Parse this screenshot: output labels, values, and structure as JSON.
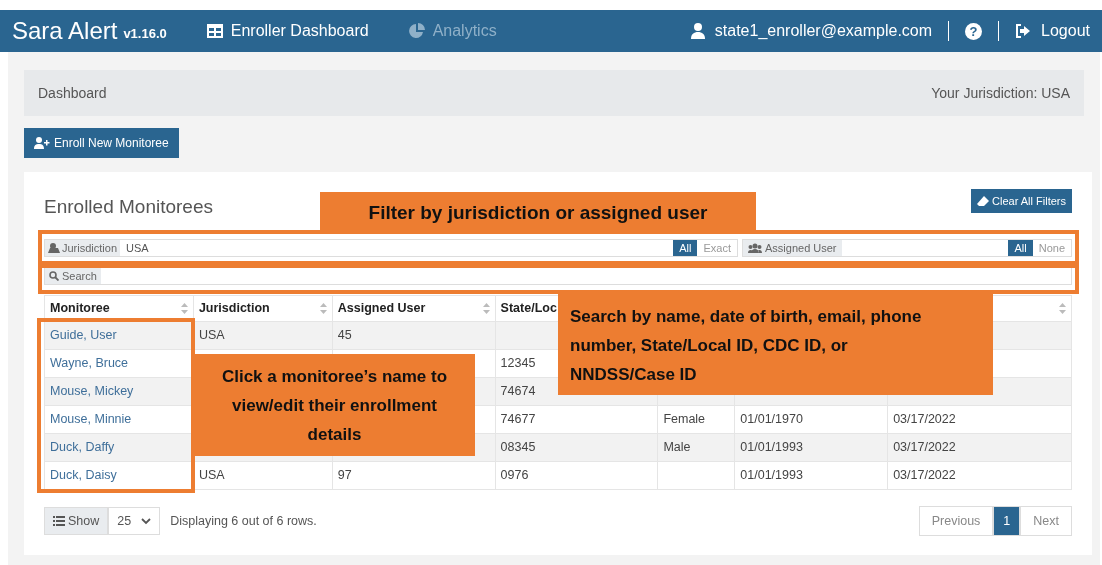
{
  "navbar": {
    "brand": "Sara Alert",
    "version": "v1.16.0",
    "links": [
      {
        "label": "Enroller Dashboard",
        "selected": true
      },
      {
        "label": "Analytics",
        "selected": false
      }
    ],
    "user": "state1_enroller@example.com",
    "help": "?",
    "logout": "Logout"
  },
  "breadcrumb": {
    "page": "Dashboard",
    "jurisdiction": "Your Jurisdiction: USA"
  },
  "enroll_button": "Enroll New Monitoree",
  "card": {
    "title": "Enrolled Monitorees",
    "clear_button": "Clear All Filters",
    "jurisdiction_filter": {
      "label": "Jurisdiction",
      "value": "USA",
      "options": [
        {
          "label": "All",
          "selected": true
        },
        {
          "label": "Exact",
          "selected": false
        }
      ]
    },
    "assigned_user_filter": {
      "label": "Assigned User",
      "options": [
        {
          "label": "All",
          "selected": true
        },
        {
          "label": "None",
          "selected": false
        }
      ]
    },
    "search": {
      "label": "Search"
    }
  },
  "table": {
    "columns": [
      "Monitoree",
      "Jurisdiction",
      "Assigned User",
      "State/Loc"
    ],
    "rows": [
      {
        "monitoree": "Guide, User",
        "jurisdiction": "USA",
        "assigned_user": "45"
      },
      {
        "monitoree": "Wayne, Bruce",
        "state_local_id": "12345"
      },
      {
        "monitoree": "Mouse, Mickey",
        "state_local_id": "74674"
      },
      {
        "monitoree": "Mouse, Minnie",
        "state_local_id": "74677",
        "column_5": "Female",
        "column_6": "01/01/1970",
        "column_7": "03/17/2022"
      },
      {
        "monitoree": "Duck, Daffy",
        "state_local_id": "08345",
        "column_5": "Male",
        "column_6": "01/01/1993",
        "column_7": "03/17/2022"
      },
      {
        "monitoree": "Duck, Daisy",
        "jurisdiction": "USA",
        "assigned_user": "97",
        "state_local_id": "0976",
        "column_6": "01/01/1993",
        "column_7": "03/17/2022"
      }
    ]
  },
  "footer": {
    "show": "Show",
    "page_size": "25",
    "summary": "Displaying 6 out of 6 rows.",
    "pagination": [
      {
        "label": "Previous",
        "kind": "nav",
        "selected": false
      },
      {
        "label": "1",
        "kind": "page",
        "selected": true
      },
      {
        "label": "Next",
        "kind": "nav",
        "selected": false
      }
    ]
  },
  "annotations": [
    {
      "kind": "filter",
      "text": "Filter by jurisdiction or assigned user"
    },
    {
      "kind": "search",
      "text": "Search by name, date of birth, email, phone number, State/Local ID, CDC ID, or NNDSS/Case ID"
    },
    {
      "kind": "name",
      "text": "Click a monitoree’s name to view/edit their enrollment details"
    }
  ]
}
